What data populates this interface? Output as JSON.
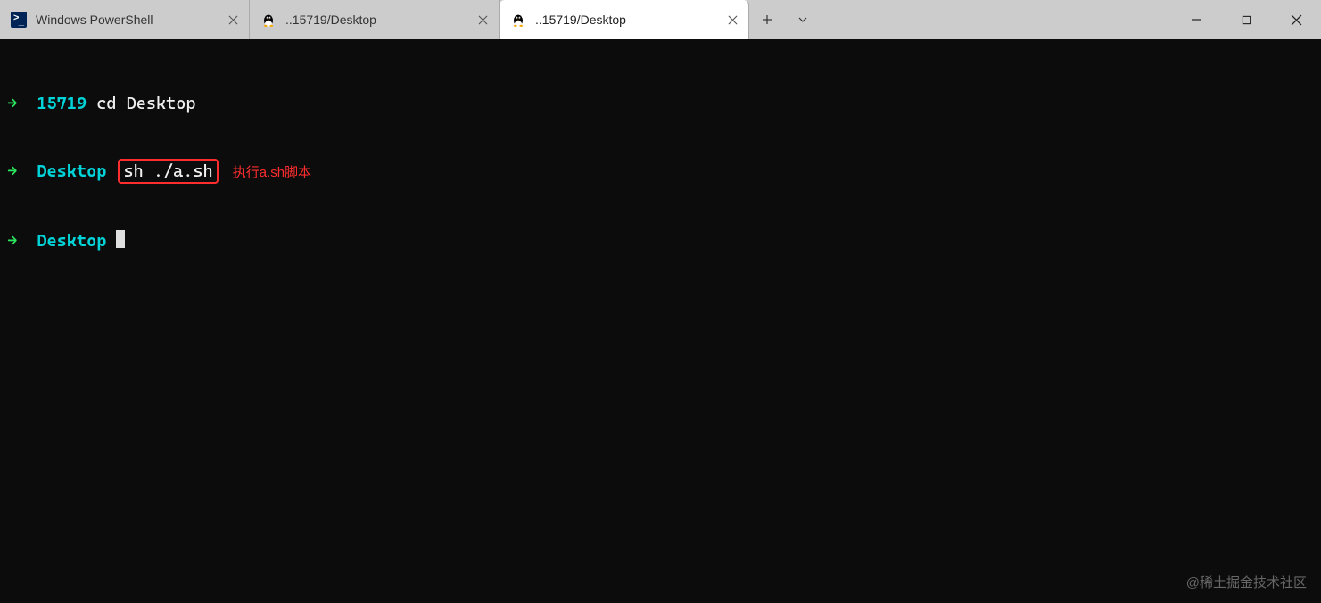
{
  "tabs": [
    {
      "label": "Windows PowerShell",
      "icon": "powershell",
      "active": false
    },
    {
      "label": "..15719/Desktop",
      "icon": "tux",
      "active": false
    },
    {
      "label": "..15719/Desktop",
      "icon": "tux",
      "active": true
    }
  ],
  "terminal": {
    "lines": [
      {
        "arrow": "→",
        "cwd": "15719",
        "cmd": "cd Desktop",
        "highlight": false
      },
      {
        "arrow": "→",
        "cwd": "Desktop",
        "cmd": "sh ./a.sh",
        "highlight": true,
        "annotation": "执行a.sh脚本"
      },
      {
        "arrow": "→",
        "cwd": "Desktop",
        "cmd": "",
        "cursor": true
      }
    ]
  },
  "watermark": "@稀土掘金技术社区",
  "icons": {
    "close": "×",
    "plus": "+",
    "chevron": "˅"
  }
}
